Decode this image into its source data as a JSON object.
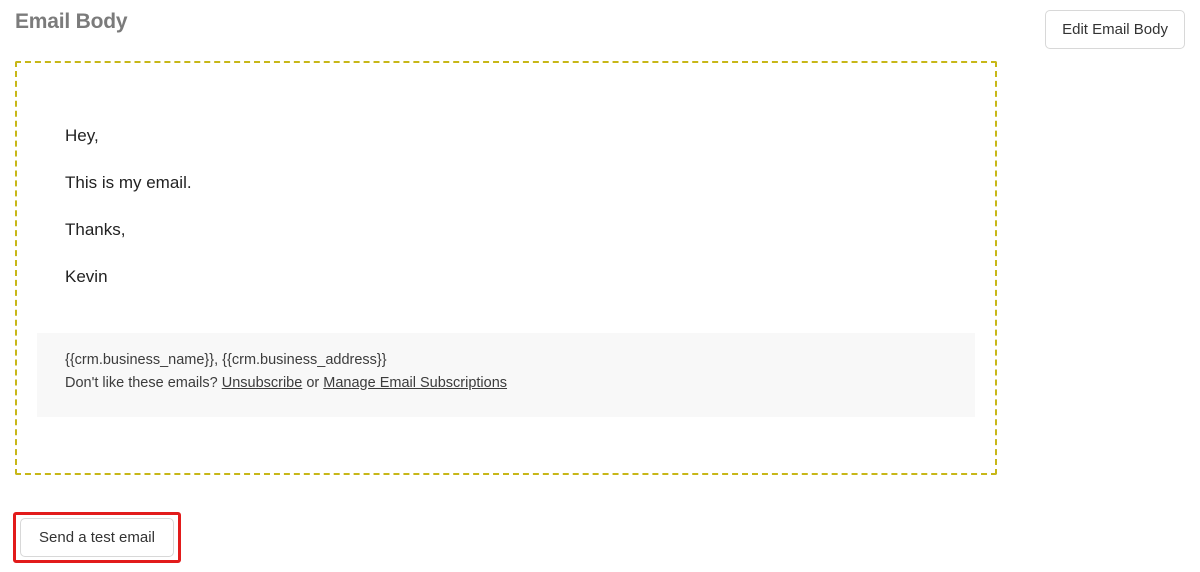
{
  "header": {
    "title": "Email Body",
    "edit_button": "Edit Email Body"
  },
  "email": {
    "greeting": "Hey,",
    "body": "This is my email.",
    "signoff": "Thanks,",
    "signature": "Kevin"
  },
  "footer": {
    "merge_vars": "{{crm.business_name}}, {{crm.business_address}}",
    "prefix": "Don't like these emails? ",
    "unsubscribe": "Unsubscribe",
    "middle": " or ",
    "manage": "Manage Email Subscriptions"
  },
  "actions": {
    "send_test": "Send a test email"
  }
}
